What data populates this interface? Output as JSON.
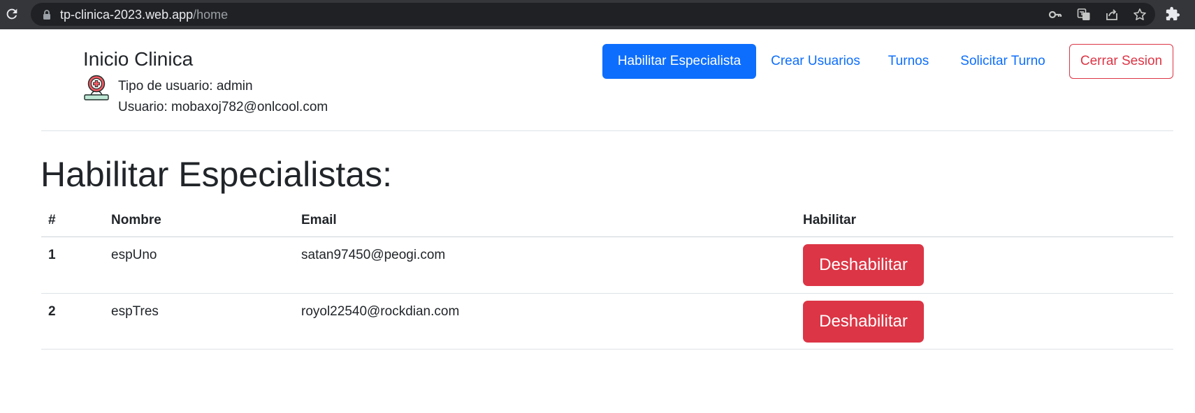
{
  "browser": {
    "url_host": "tp-clinica-2023.web.app",
    "url_path": "/home",
    "icons": [
      "reload-icon",
      "lock-icon",
      "key-icon",
      "translate-icon",
      "share-icon",
      "star-icon",
      "extensions-icon"
    ]
  },
  "header": {
    "brand": "Inicio Clinica",
    "user_type": "Tipo de usuario: admin",
    "user_email": "Usuario: mobaxoj782@onlcool.com"
  },
  "nav": {
    "habilitar": "Habilitar Especialista",
    "crear_usuarios": "Crear Usuarios",
    "turnos": "Turnos",
    "solicitar_turno": "Solicitar Turno",
    "cerrar_sesion": "Cerrar Sesion"
  },
  "main": {
    "title": "Habilitar Especialistas:"
  },
  "table": {
    "headers": [
      "#",
      "Nombre",
      "Email",
      "Habilitar"
    ],
    "rows": [
      {
        "num": "1",
        "nombre": "espUno",
        "email": "satan97450@peogi.com",
        "action": "Deshabilitar"
      },
      {
        "num": "2",
        "nombre": "espTres",
        "email": "royol22540@rockdian.com",
        "action": "Deshabilitar"
      }
    ]
  },
  "colors": {
    "primary": "#0d6efd",
    "danger": "#dc3545",
    "chrome": "#35363a"
  }
}
